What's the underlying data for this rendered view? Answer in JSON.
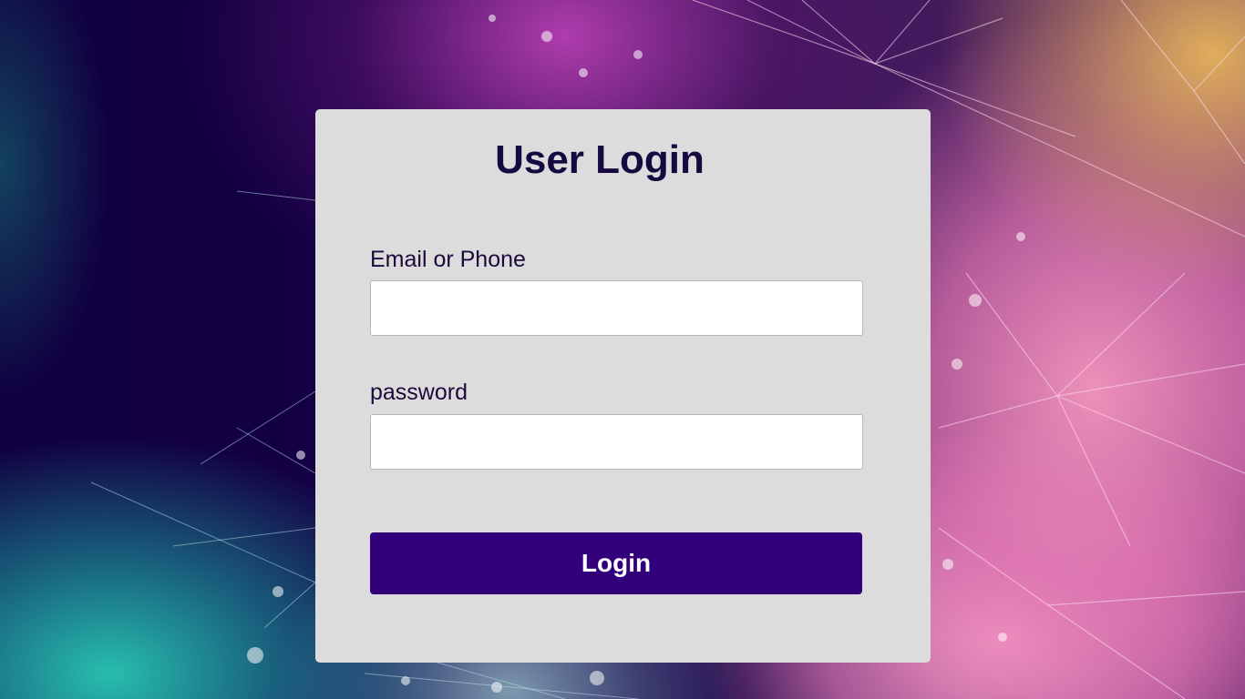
{
  "login": {
    "title": "User Login",
    "email_label": "Email or Phone",
    "email_value": "",
    "password_label": "password",
    "password_value": "",
    "submit_label": "Login"
  },
  "colors": {
    "card_background": "#dcdcdc",
    "title_text": "#160940",
    "button_background": "#33007b",
    "button_text": "#ffffff",
    "page_background": "#100040"
  }
}
